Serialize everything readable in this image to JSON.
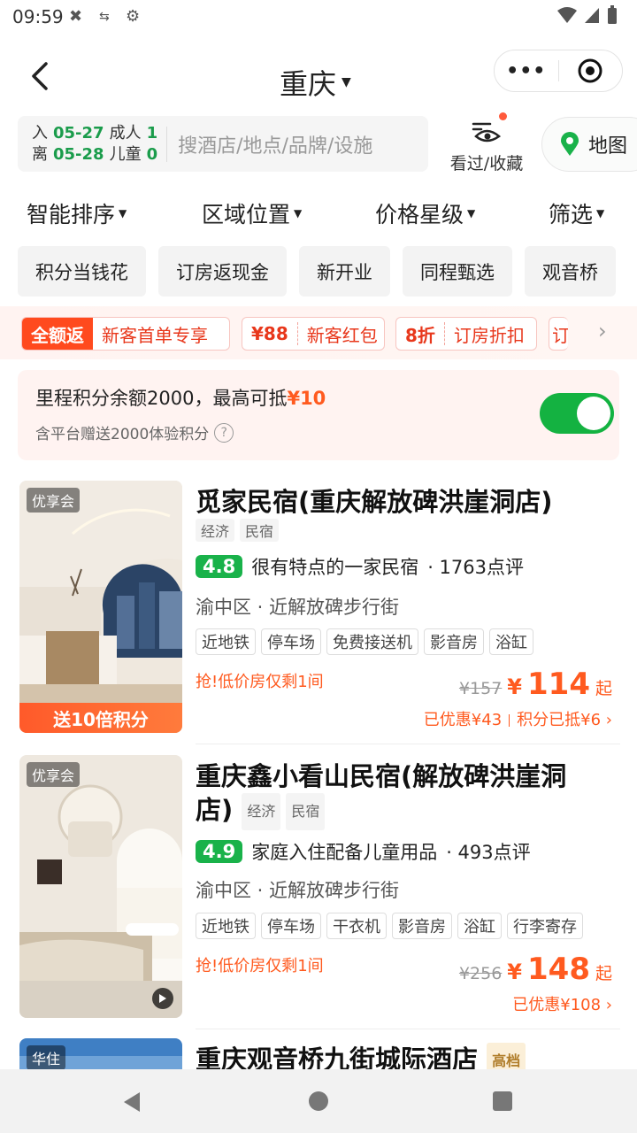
{
  "status_bar": {
    "time": "09:59"
  },
  "title_bar": {
    "city": "重庆"
  },
  "search": {
    "checkin_label": "入",
    "checkin_date": "05-27",
    "checkout_label": "离",
    "checkout_date": "05-28",
    "adult_label": "成人",
    "adult_count": "1",
    "child_label": "儿童",
    "child_count": "0",
    "placeholder": "搜酒店/地点/品牌/设施",
    "viewed_label": "看过/收藏",
    "map_label": "地图"
  },
  "sort": [
    "智能排序",
    "区域位置",
    "价格星级",
    "筛选"
  ],
  "quick_tags": [
    "积分当钱花",
    "订房返现金",
    "新开业",
    "同程甄选",
    "观音桥"
  ],
  "coupons": [
    {
      "badge": "全额返",
      "text": "新客首单专享"
    },
    {
      "badge": "¥88",
      "text": "新客红包"
    },
    {
      "badge": "8折",
      "text": "订房折扣"
    },
    {
      "badge": "订",
      "text": ""
    }
  ],
  "points": {
    "text": "里程积分余额2000，最高可抵",
    "amount": "¥10",
    "sub": "含平台赠送2000体验积分"
  },
  "hotels": [
    {
      "member_tag": "优享会",
      "bonus_banner": "送10倍积分",
      "name": "觅家民宿(重庆解放碑洪崖洞店)",
      "tags": [
        "经济",
        "民宿"
      ],
      "score": "4.8",
      "review_desc": "很有特点的一家民宿",
      "review_count": "· 1763点评",
      "location": "渝中区 · 近解放碑步行街",
      "facilities": [
        "近地铁",
        "停车场",
        "免费接送机",
        "影音房",
        "浴缸"
      ],
      "urgent": "抢!低价房仅剩1间",
      "old_price": "¥157",
      "price": "114",
      "price_suffix": "起",
      "discount": "已优惠¥43",
      "discount2": "积分已抵¥6"
    },
    {
      "member_tag": "优享会",
      "name_line1": "重庆鑫小看山民宿(解放碑洪崖洞",
      "name_line2": "店)",
      "tags": [
        "经济",
        "民宿"
      ],
      "score": "4.9",
      "review_desc": "家庭入住配备儿童用品",
      "review_count": "· 493点评",
      "location": "渝中区 · 近解放碑步行街",
      "facilities": [
        "近地铁",
        "停车场",
        "干衣机",
        "影音房",
        "浴缸",
        "行李寄存"
      ],
      "urgent": "抢!低价房仅剩1间",
      "old_price": "¥256",
      "price": "148",
      "price_suffix": "起",
      "discount": "已优惠¥108"
    },
    {
      "member_tag": "华住",
      "name": "重庆观音桥九街城际酒店",
      "grade": "高档"
    }
  ],
  "colors": {
    "accent_orange": "#ff5a1f",
    "brand_green": "#19b24a",
    "toggle_on": "#14b241"
  }
}
